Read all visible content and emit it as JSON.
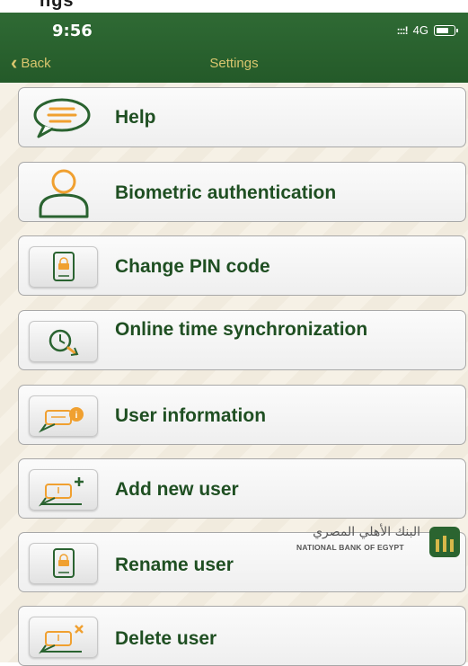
{
  "top_partial_text": "ngs",
  "status": {
    "time": "9:56",
    "signal": ":::!",
    "network": "4G"
  },
  "nav": {
    "back_label": "Back",
    "title": "Settings"
  },
  "items": [
    {
      "label": "Help",
      "icon": "chat-bubble-icon"
    },
    {
      "label": "Biometric authentication",
      "icon": "person-icon"
    },
    {
      "label": "Change PIN code",
      "icon": "tablet-lock-icon"
    },
    {
      "label": "Online time synchronization",
      "icon": "clock-sync-icon"
    },
    {
      "label": "User information",
      "icon": "user-info-icon"
    },
    {
      "label": "Add new user",
      "icon": "add-user-icon"
    },
    {
      "label": "Rename user",
      "icon": "tablet-lock-icon"
    },
    {
      "label": "Delete user",
      "icon": "delete-user-icon"
    }
  ],
  "logo": {
    "arabic": "البنك الأهلي المصري",
    "english": "NATIONAL BANK OF EGYPT"
  },
  "colors": {
    "header": "#2a6330",
    "accent": "#d9c66e",
    "label": "#1f4f22"
  }
}
